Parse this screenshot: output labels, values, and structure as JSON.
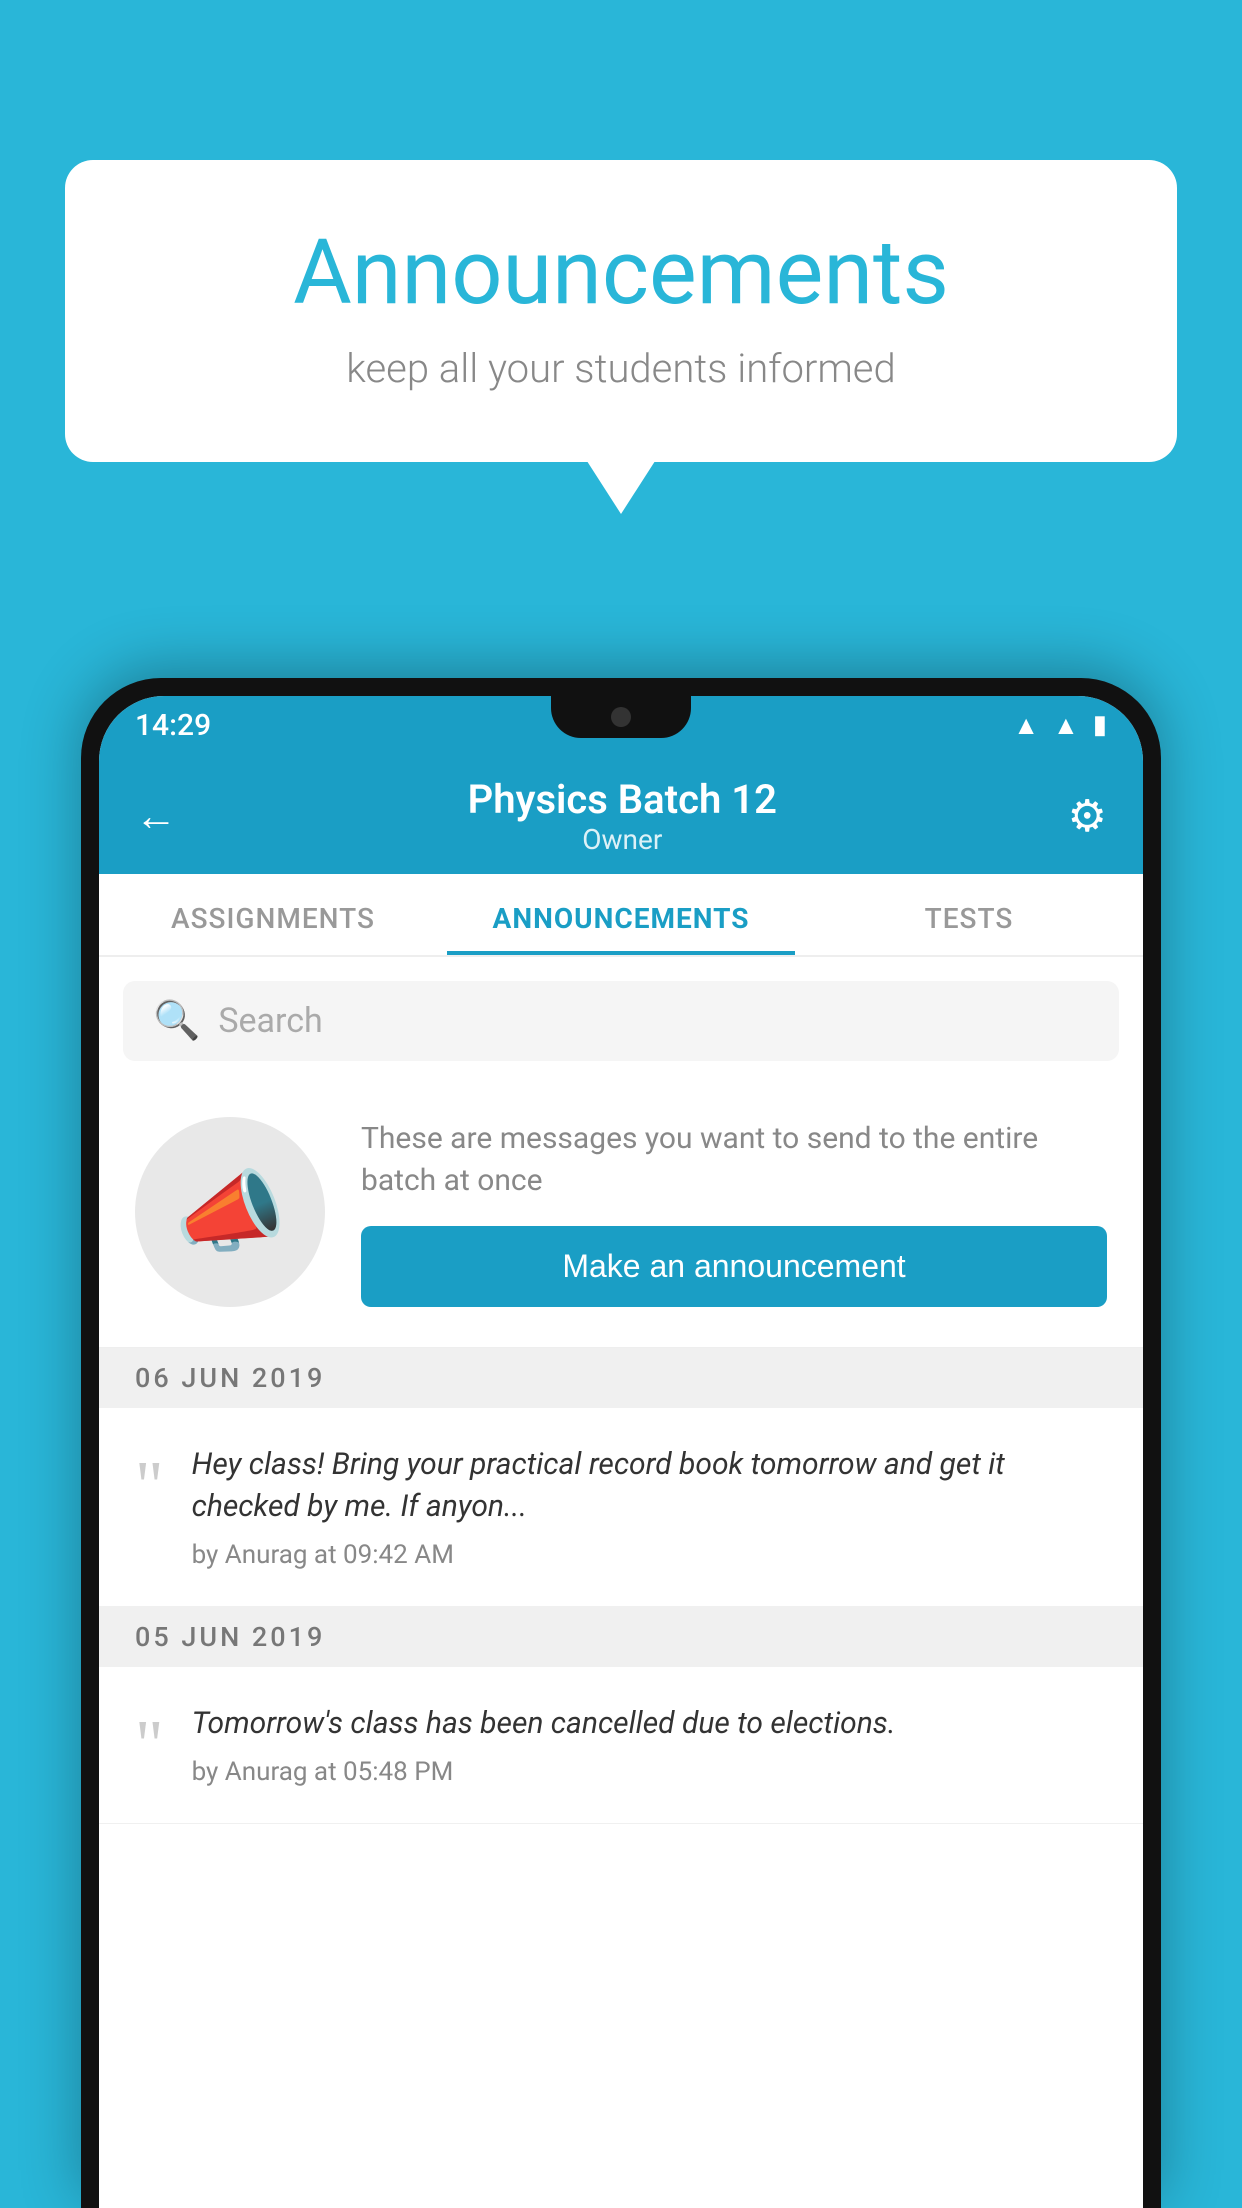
{
  "background_color": "#29b6d8",
  "speech_bubble": {
    "title": "Announcements",
    "subtitle": "keep all your students informed"
  },
  "phone": {
    "status_bar": {
      "time": "14:29",
      "icons": [
        "wifi",
        "signal",
        "battery"
      ]
    },
    "header": {
      "title": "Physics Batch 12",
      "subtitle": "Owner",
      "back_label": "←",
      "gear_label": "⚙"
    },
    "tabs": [
      {
        "label": "ASSIGNMENTS",
        "active": false
      },
      {
        "label": "ANNOUNCEMENTS",
        "active": true
      },
      {
        "label": "TESTS",
        "active": false
      }
    ],
    "search": {
      "placeholder": "Search"
    },
    "promo": {
      "description": "These are messages you want to send to the entire batch at once",
      "button_label": "Make an announcement"
    },
    "announcements": [
      {
        "date": "06  JUN  2019",
        "text": "Hey class! Bring your practical record book tomorrow and get it checked by me. If anyon...",
        "meta": "by Anurag at 09:42 AM"
      },
      {
        "date": "05  JUN  2019",
        "text": "Tomorrow's class has been cancelled due to elections.",
        "meta": "by Anurag at 05:48 PM"
      }
    ]
  }
}
